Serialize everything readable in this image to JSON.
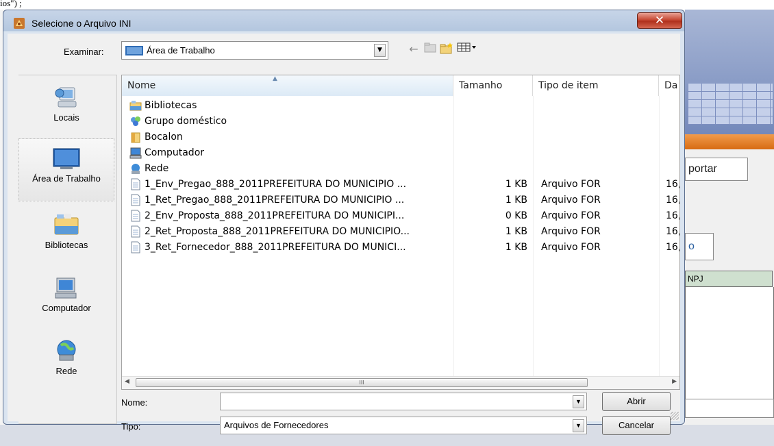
{
  "background": {
    "top_cut_text": "ios\") ;",
    "import_button": "portar",
    "button2": "o",
    "column_header": "NPJ"
  },
  "dialog": {
    "title": "Selecione o Arquivo INI",
    "close_glyph": "✕",
    "look_in": {
      "label": "Examinar:",
      "value": "Área de Trabalho"
    },
    "places": [
      {
        "label": "Locais"
      },
      {
        "label": "Área de Trabalho"
      },
      {
        "label": "Bibliotecas"
      },
      {
        "label": "Computador"
      },
      {
        "label": "Rede"
      }
    ],
    "columns": {
      "name": "Nome",
      "size": "Tamanho",
      "type": "Tipo de item",
      "date": "Da"
    },
    "items": [
      {
        "icon": "libraries-icon",
        "name": "Bibliotecas",
        "size": "",
        "type": "",
        "date": ""
      },
      {
        "icon": "homegroup-icon",
        "name": "Grupo doméstico",
        "size": "",
        "type": "",
        "date": ""
      },
      {
        "icon": "user-folder-icon",
        "name": "Bocalon",
        "size": "",
        "type": "",
        "date": ""
      },
      {
        "icon": "computer-icon",
        "name": "Computador",
        "size": "",
        "type": "",
        "date": ""
      },
      {
        "icon": "network-icon",
        "name": "Rede",
        "size": "",
        "type": "",
        "date": ""
      },
      {
        "icon": "file-icon",
        "name": "1_Env_Pregao_888_2011PREFEITURA DO MUNICIPIO ...",
        "size": "1 KB",
        "type": "Arquivo FOR",
        "date": "16,"
      },
      {
        "icon": "file-icon",
        "name": "1_Ret_Pregao_888_2011PREFEITURA DO MUNICIPIO ...",
        "size": "1 KB",
        "type": "Arquivo FOR",
        "date": "16,"
      },
      {
        "icon": "file-icon",
        "name": "2_Env_Proposta_888_2011PREFEITURA DO MUNICIPI...",
        "size": "0 KB",
        "type": "Arquivo FOR",
        "date": "16,"
      },
      {
        "icon": "file-icon",
        "name": "2_Ret_Proposta_888_2011PREFEITURA DO MUNICIPIO...",
        "size": "1 KB",
        "type": "Arquivo FOR",
        "date": "16,"
      },
      {
        "icon": "file-icon",
        "name": "3_Ret_Fornecedor_888_2011PREFEITURA DO MUNICI...",
        "size": "1 KB",
        "type": "Arquivo FOR",
        "date": "16,"
      }
    ],
    "scroll_thumb": "III",
    "filename": {
      "label": "Nome:",
      "value": ""
    },
    "filetype": {
      "label": "Tipo:",
      "value": "Arquivos de Fornecedores"
    },
    "buttons": {
      "open": "Abrir",
      "cancel": "Cancelar"
    }
  }
}
